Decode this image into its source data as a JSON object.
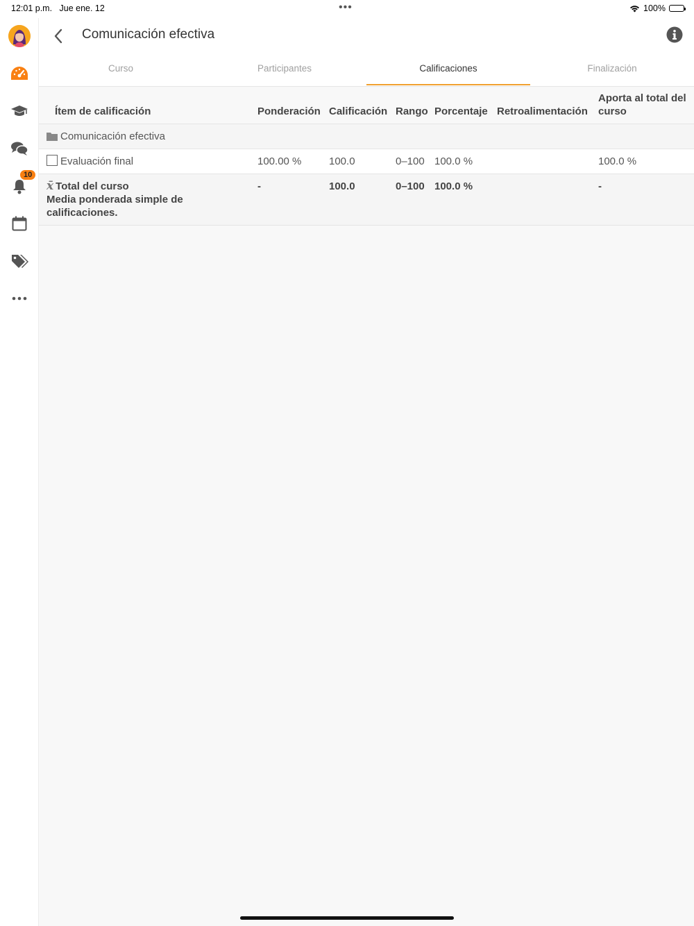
{
  "status": {
    "time": "12:01 p.m.",
    "date": "Jue ene. 12",
    "dots": "•••",
    "battery": "100%"
  },
  "header": {
    "title": "Comunicación efectiva"
  },
  "sidebar": {
    "notification_count": "10"
  },
  "tabs": [
    {
      "label": "Curso",
      "active": false
    },
    {
      "label": "Participantes",
      "active": false
    },
    {
      "label": "Calificaciones",
      "active": true
    },
    {
      "label": "Finalización",
      "active": false
    }
  ],
  "table": {
    "headers": {
      "item": "Ítem de calificación",
      "weight": "Ponderación",
      "grade": "Calificación",
      "range": "Rango",
      "percentage": "Porcentaje",
      "feedback": "Retroalimentación",
      "contribution": "Aporta al total del curso"
    },
    "category": {
      "name": "Comunicación efectiva"
    },
    "item": {
      "name": "Evaluación final",
      "weight": "100.00 %",
      "grade": "100.0",
      "range": "0–100",
      "percentage": "100.0 %",
      "feedback": "",
      "contribution": "100.0 %"
    },
    "total": {
      "name": "Total del curso",
      "description": "Media ponderada simple de calificaciones.",
      "weight": "-",
      "grade": "100.0",
      "range": "0–100",
      "percentage": "100.0 %",
      "feedback": "",
      "contribution": "-"
    }
  },
  "colors": {
    "accent": "#f98012",
    "tab_underline": "#f0a030",
    "avatar_bg": "#f6a51e"
  }
}
